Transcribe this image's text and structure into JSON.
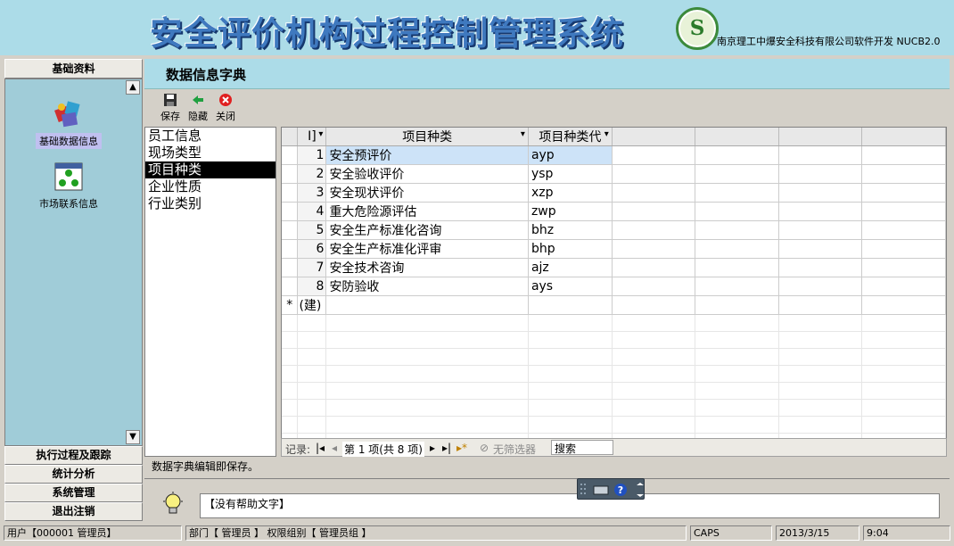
{
  "banner": {
    "title": "安全评价机构过程控制管理系统",
    "logo_letter": "S",
    "subtitle": "南京理工中爆安全科技有限公司软件开发 NUCB2.0"
  },
  "sidebar": {
    "header": "基础资料",
    "items": [
      {
        "label": "基础数据信息",
        "icon": "database-icon",
        "active": true
      },
      {
        "label": "市场联系信息",
        "icon": "network-icon",
        "active": false
      }
    ],
    "scroll_up": "▲",
    "scroll_down": "▼",
    "bottom_buttons": [
      "执行过程及跟踪",
      "统计分析",
      "系统管理",
      "退出注销"
    ]
  },
  "content": {
    "title": "数据信息字典",
    "toolbar": {
      "save": "保存",
      "hide": "隐藏",
      "close": "关闭"
    },
    "categories": [
      "员工信息",
      "现场类型",
      "项目种类",
      "企业性质",
      "行业类别"
    ],
    "selected_category": "项目种类",
    "grid": {
      "columns": [
        "I]",
        "项目种类",
        "项目种类代"
      ],
      "rows": [
        {
          "id": "1",
          "name": "安全预评价",
          "code": "ayp"
        },
        {
          "id": "2",
          "name": "安全验收评价",
          "code": "ysp"
        },
        {
          "id": "3",
          "name": "安全现状评价",
          "code": "xzp"
        },
        {
          "id": "4",
          "name": "重大危险源评估",
          "code": "zwp"
        },
        {
          "id": "5",
          "name": "安全生产标准化咨询",
          "code": "bhz"
        },
        {
          "id": "6",
          "name": "安全生产标准化评审",
          "code": "bhp"
        },
        {
          "id": "7",
          "name": "安全技术咨询",
          "code": "ajz"
        },
        {
          "id": "8",
          "name": "安防验收",
          "code": "ays"
        }
      ],
      "new_row_marker": "*",
      "new_row_text": "(建)"
    },
    "record_nav": {
      "label": "记录:",
      "position": "第 1 项(共 8 项)",
      "filter": "无筛选器",
      "search": "搜索"
    },
    "status_message": "数据字典编辑即保存。",
    "help_text": "【没有帮助文字】"
  },
  "statusbar": {
    "user": "用户【000001 管理员】",
    "dept": "部门【 管理员 】 权限组别【 管理员组 】",
    "caps": "CAPS",
    "date": "2013/3/15",
    "time": "9:04"
  },
  "colors": {
    "banner_bg": "#acdce8",
    "title_blue": "#3f79bf",
    "sidebar_bg": "#a0ccd8",
    "selection": "#cde3f8"
  }
}
